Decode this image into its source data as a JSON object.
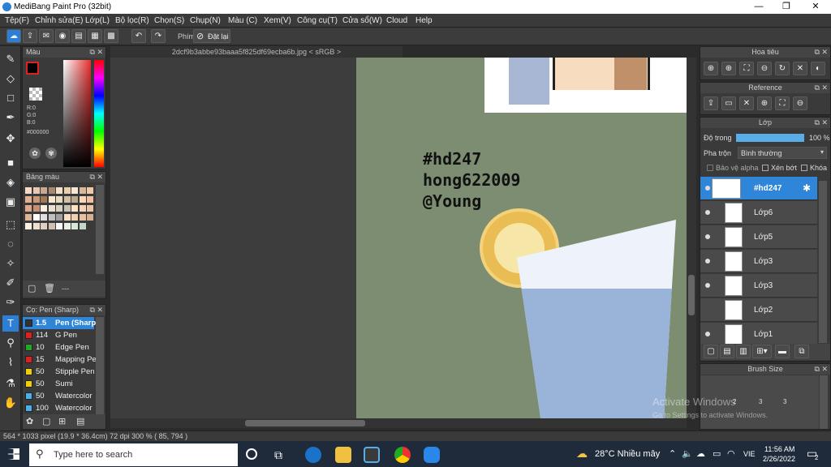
{
  "window": {
    "title": "MediBang Paint Pro (32bit)",
    "minimize": "—",
    "maximize": "❐",
    "close": "✕"
  },
  "menu": [
    "Tệp(F)",
    "Chỉnh sửa(E)",
    "Lớp(L)",
    "Bộ lọc(R)",
    "Chọn(S)",
    "Chụp(N)",
    "Màu (C)",
    "Xem(V)",
    "Công cụ(T)",
    "Cửa sổ(W)",
    "Cloud",
    "Help"
  ],
  "toolbar": {
    "key_label": "Phím",
    "reset_label": "Đặt lại"
  },
  "document": {
    "tab": "2dcf9b3abbe93baaa5f825df69ecba6b.jpg < sRGB >"
  },
  "color_panel": {
    "title": "Màu",
    "r": "R:0",
    "g": "G:0",
    "b": "B:0",
    "hex": "#000000"
  },
  "palette_panel": {
    "title": "Bảng màu",
    "footer": "---"
  },
  "brush_panel": {
    "title": "Cọ: Pen (Sharp)",
    "items": [
      {
        "size": "1.5",
        "name": "Pen (Sharp)",
        "color": "#333333"
      },
      {
        "size": "114",
        "name": "G Pen",
        "color": "#e02020"
      },
      {
        "size": "10",
        "name": "Edge Pen",
        "color": "#22aa22"
      },
      {
        "size": "15",
        "name": "Mapping Pen",
        "color": "#e02020"
      },
      {
        "size": "50",
        "name": "Stipple Pen",
        "color": "#f0d000"
      },
      {
        "size": "50",
        "name": "Sumi",
        "color": "#f0d000"
      },
      {
        "size": "50",
        "name": "Watercolor",
        "color": "#4ab0e8"
      },
      {
        "size": "100",
        "name": "Watercolor",
        "color": "#4ab0e8"
      }
    ]
  },
  "artwork": {
    "line1": "#hd247",
    "line2": "hong622009",
    "line3": "@Young"
  },
  "navigator": {
    "title": "Hoa tiêu"
  },
  "reference": {
    "title": "Reference"
  },
  "layer_panel": {
    "title": "Lớp",
    "opacity_label": "Độ trong",
    "opacity_value": "100 %",
    "opacity_fraction": 1.0,
    "blend_label": "Pha trộn",
    "blend_value": "Bình thường",
    "protect_alpha": "Bảo vệ alpha",
    "clipping": "Xén bớt",
    "lock": "Khóa",
    "layers": [
      "#hd247",
      "Lớp6",
      "Lớp5",
      "Lớp3",
      "Lớp3",
      "Lớp2",
      "Lớp1"
    ]
  },
  "brush_size": {
    "title": "Brush Size",
    "sizes": [
      "2",
      "3",
      "3"
    ]
  },
  "watermark": {
    "line1": "Activate Windows",
    "line2": "Go to Settings to activate Windows."
  },
  "status": {
    "text": "564 * 1033 pixel  (19.9 * 36.4cm)  72 dpi  300 %  ( 85, 794 )"
  },
  "taskbar": {
    "search_placeholder": "Type here to search",
    "weather": "28°C  Nhiều mây",
    "lang": "VIE",
    "time": "11:56 AM",
    "date": "2/26/2022",
    "notif_count": "2"
  }
}
